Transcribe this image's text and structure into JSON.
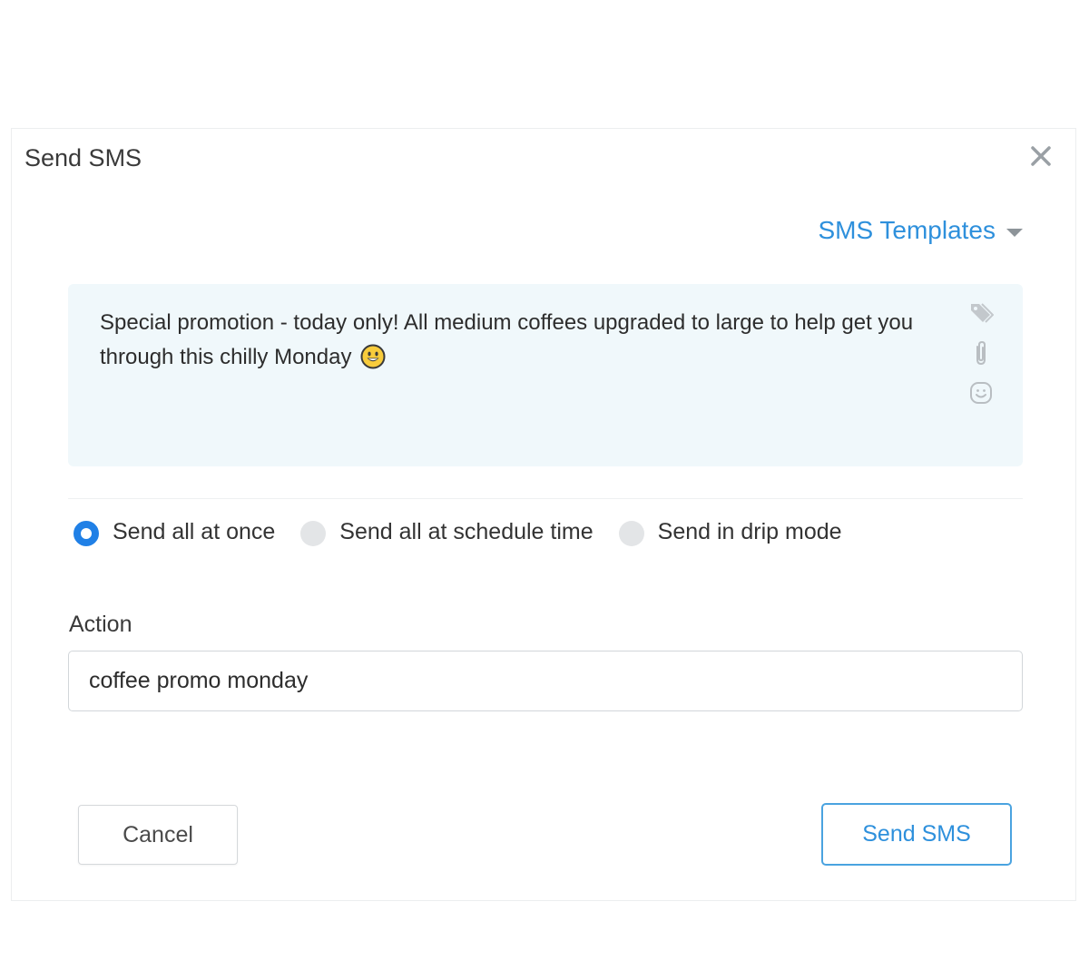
{
  "dialog": {
    "title": "Send SMS",
    "close_icon": "close-icon"
  },
  "templates": {
    "label": "SMS Templates",
    "caret_icon": "caret-down-icon"
  },
  "message": {
    "text": "Special promotion - today only! All medium coffees upgraded to large to help get you through this chilly Monday",
    "emoji": "grinning-face-emoji",
    "side_icons": [
      "tag-icon",
      "paperclip-icon",
      "smiley-icon"
    ]
  },
  "send_mode": {
    "options": [
      {
        "label": "Send all at once",
        "selected": true
      },
      {
        "label": "Send all at schedule time",
        "selected": false
      },
      {
        "label": "Send in drip mode",
        "selected": false
      }
    ]
  },
  "action": {
    "label": "Action",
    "value": "coffee promo monday"
  },
  "buttons": {
    "cancel": "Cancel",
    "send": "Send SMS"
  },
  "colors": {
    "accent": "#2e90dc",
    "radio_active": "#2080e6",
    "message_bg": "#f0f8fb"
  }
}
